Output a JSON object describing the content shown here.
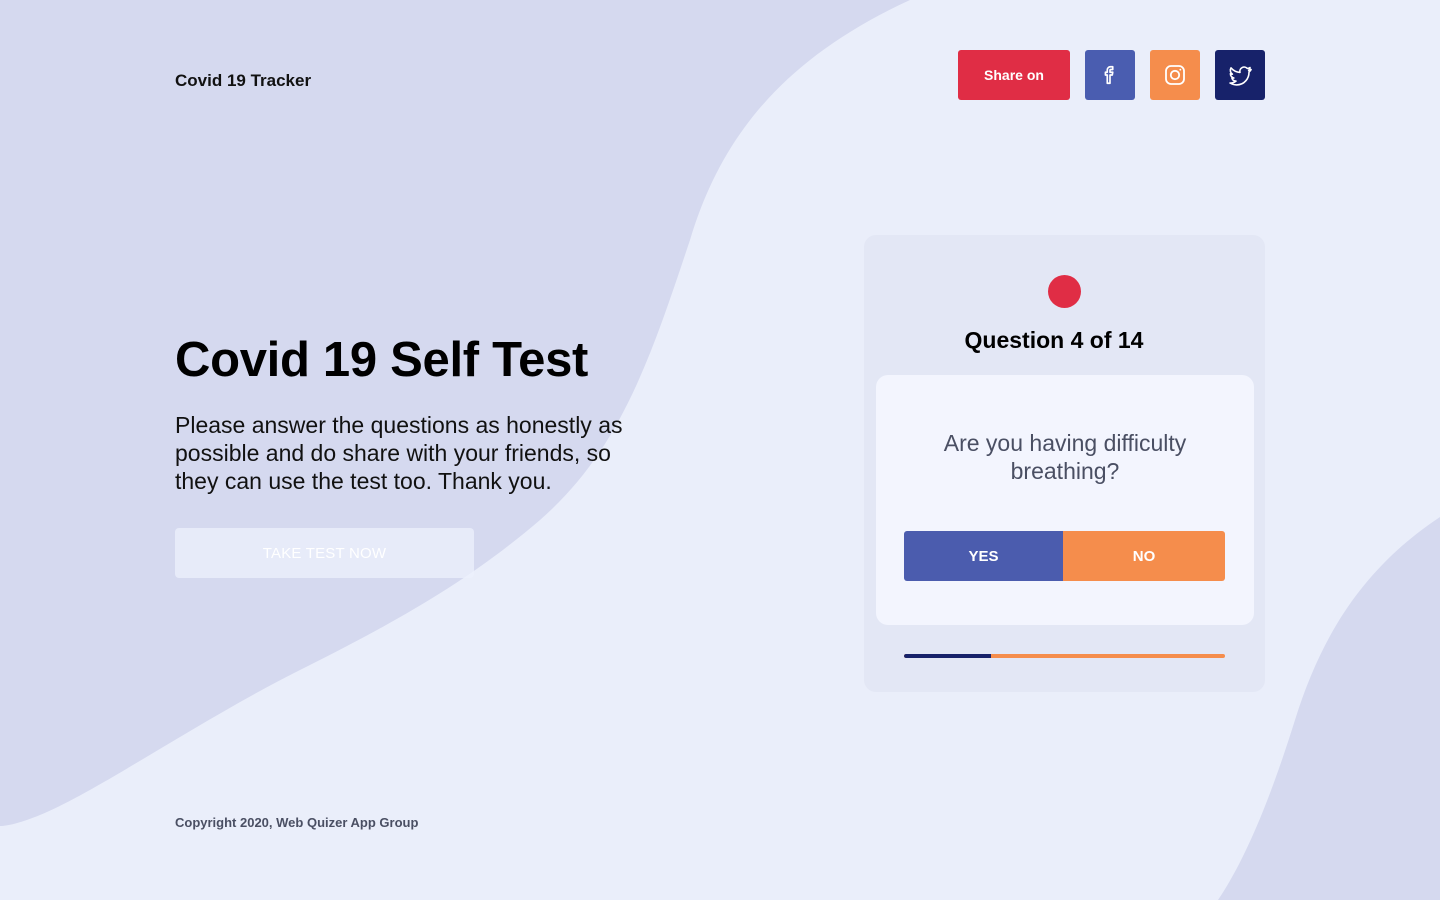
{
  "header": {
    "brand": "Covid 19 Tracker",
    "share_label": "Share on",
    "socials": [
      {
        "name": "facebook",
        "icon": "facebook-icon",
        "color": "#4a5db0"
      },
      {
        "name": "instagram",
        "icon": "instagram-icon",
        "color": "#f58d4c"
      },
      {
        "name": "twitter",
        "icon": "twitter-icon",
        "color": "#17226a"
      }
    ]
  },
  "hero": {
    "title": "Covid 19 Self Test",
    "description": "Please answer the questions as honestly as possible and do share with your friends, so they can use the test too. Thank you.",
    "cta_label": "TAKE TEST NOW"
  },
  "quiz": {
    "counter": "Question 4 of 14",
    "question": "Are you having difficulty breathing?",
    "yes_label": "YES",
    "no_label": "NO",
    "progress_fraction": 0.27
  },
  "footer": {
    "copyright": "Copyright 2020, Web Quizer App Group"
  },
  "colors": {
    "accent_red": "#e02d45",
    "blue": "#4b5cae",
    "orange": "#f58d4c",
    "navy": "#17226a",
    "background": "#eaeefa",
    "blob": "#d5d9ef"
  }
}
